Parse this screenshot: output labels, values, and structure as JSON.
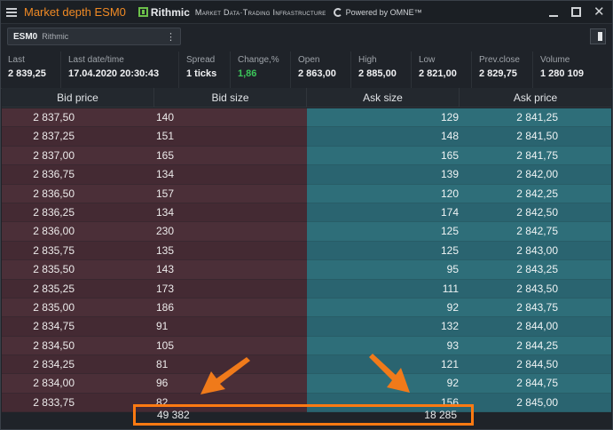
{
  "window": {
    "title": "Market depth ESM0"
  },
  "branding": {
    "rithmic": "Rithmic",
    "tagline": "Market Data·Trading Infrastructure",
    "omne": "Powered by OMNE™"
  },
  "instrument": {
    "symbol": "ESM0",
    "source": "Rithmic"
  },
  "stats": [
    {
      "label": "Last",
      "value": "2 839,25"
    },
    {
      "label": "Last date/time",
      "value": "17.04.2020 20:30:43"
    },
    {
      "label": "Spread",
      "value": "1 ticks"
    },
    {
      "label": "Change,%",
      "value": "1,86"
    },
    {
      "label": "Open",
      "value": "2 863,00"
    },
    {
      "label": "High",
      "value": "2 885,00"
    },
    {
      "label": "Low",
      "value": "2 821,00"
    },
    {
      "label": "Prev.close",
      "value": "2 829,75"
    },
    {
      "label": "Volume",
      "value": "1 280 109"
    }
  ],
  "columns": [
    "Bid price",
    "Bid size",
    "Ask size",
    "Ask price"
  ],
  "rows": [
    {
      "bid_price": "2 837,50",
      "bid_size": "140",
      "ask_size": "129",
      "ask_price": "2 841,25"
    },
    {
      "bid_price": "2 837,25",
      "bid_size": "151",
      "ask_size": "148",
      "ask_price": "2 841,50"
    },
    {
      "bid_price": "2 837,00",
      "bid_size": "165",
      "ask_size": "165",
      "ask_price": "2 841,75"
    },
    {
      "bid_price": "2 836,75",
      "bid_size": "134",
      "ask_size": "139",
      "ask_price": "2 842,00"
    },
    {
      "bid_price": "2 836,50",
      "bid_size": "157",
      "ask_size": "120",
      "ask_price": "2 842,25"
    },
    {
      "bid_price": "2 836,25",
      "bid_size": "134",
      "ask_size": "174",
      "ask_price": "2 842,50"
    },
    {
      "bid_price": "2 836,00",
      "bid_size": "230",
      "ask_size": "125",
      "ask_price": "2 842,75"
    },
    {
      "bid_price": "2 835,75",
      "bid_size": "135",
      "ask_size": "125",
      "ask_price": "2 843,00"
    },
    {
      "bid_price": "2 835,50",
      "bid_size": "143",
      "ask_size": "95",
      "ask_price": "2 843,25"
    },
    {
      "bid_price": "2 835,25",
      "bid_size": "173",
      "ask_size": "111",
      "ask_price": "2 843,50"
    },
    {
      "bid_price": "2 835,00",
      "bid_size": "186",
      "ask_size": "92",
      "ask_price": "2 843,75"
    },
    {
      "bid_price": "2 834,75",
      "bid_size": "91",
      "ask_size": "132",
      "ask_price": "2 844,00"
    },
    {
      "bid_price": "2 834,50",
      "bid_size": "105",
      "ask_size": "93",
      "ask_price": "2 844,25"
    },
    {
      "bid_price": "2 834,25",
      "bid_size": "81",
      "ask_size": "121",
      "ask_price": "2 844,50"
    },
    {
      "bid_price": "2 834,00",
      "bid_size": "96",
      "ask_size": "92",
      "ask_price": "2 844,75"
    },
    {
      "bid_price": "2 833,75",
      "bid_size": "82",
      "ask_size": "156",
      "ask_price": "2 845,00"
    }
  ],
  "totals": {
    "bid_size": "49 382",
    "ask_size": "18 285"
  },
  "colors": {
    "accent": "#f08a24",
    "highlight": "#ff7a12",
    "bid": "#4b2f38",
    "ask": "#2e6e79",
    "positive": "#3cc65a"
  }
}
